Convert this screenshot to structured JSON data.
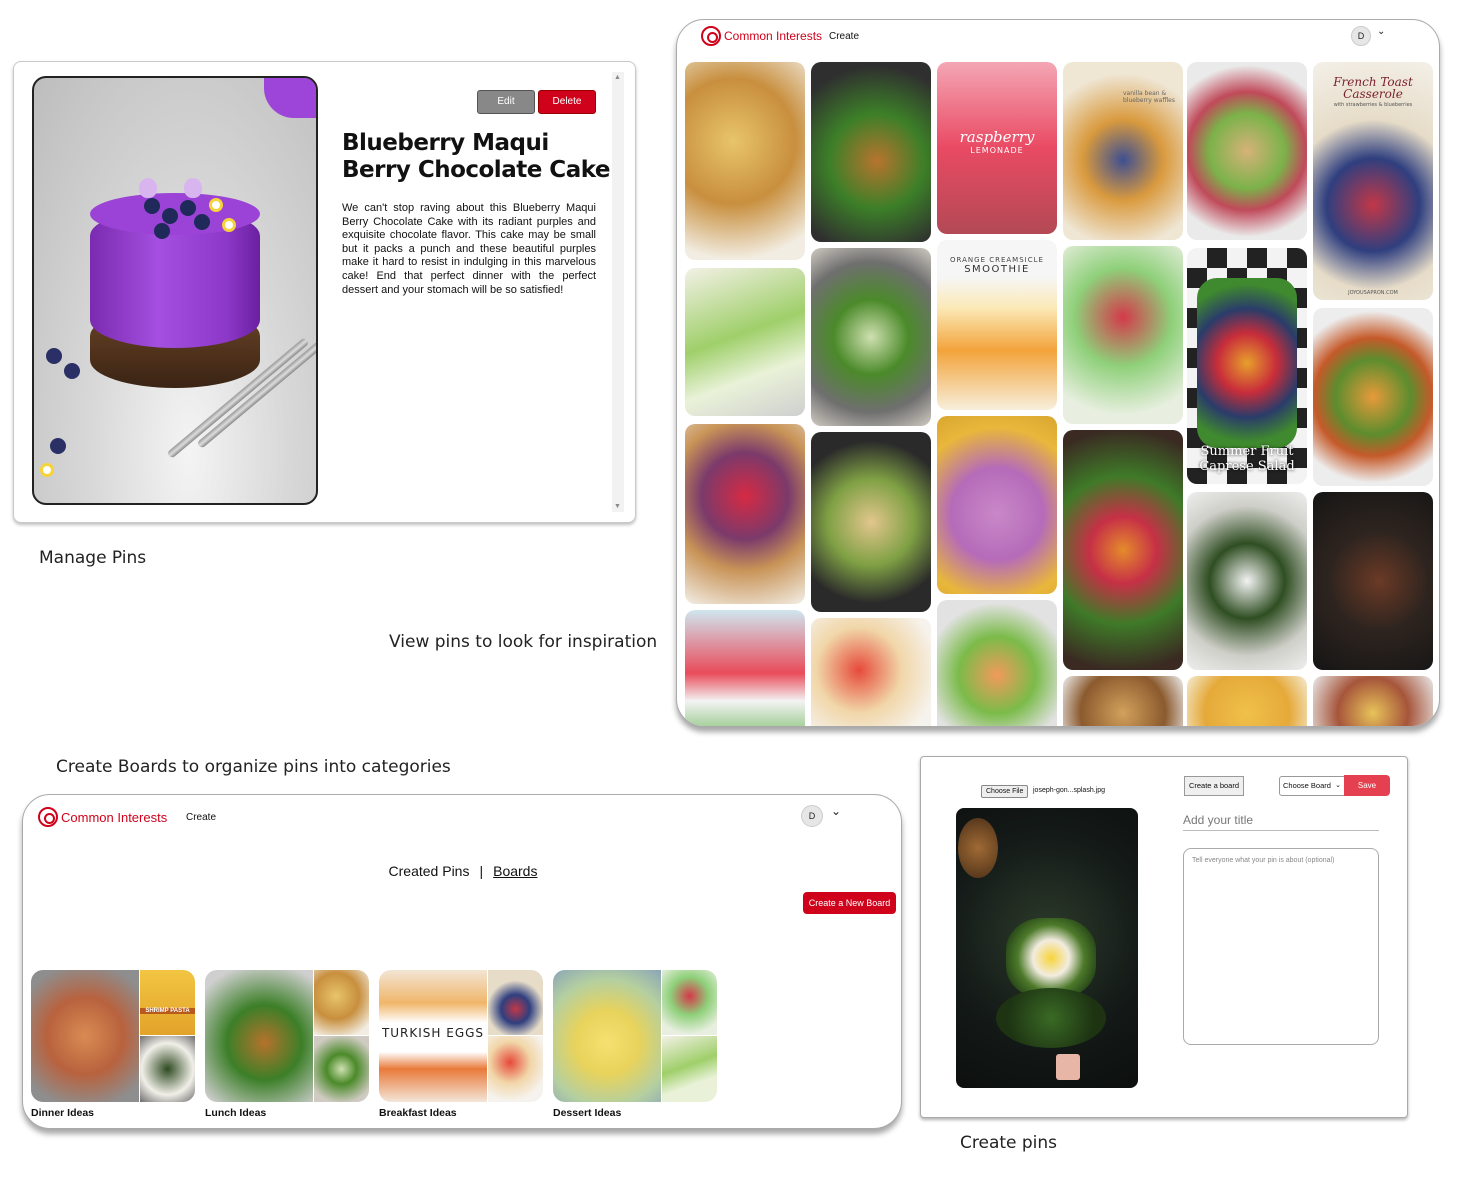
{
  "captions": {
    "manage": "Manage Pins",
    "view": "View pins to look for inspiration",
    "boards": "Create Boards to organize pins into categories",
    "create": "Create pins"
  },
  "brand": {
    "name": "Common Interests",
    "color": "#d0021b"
  },
  "nav": {
    "create": "Create",
    "avatar_letter": "D"
  },
  "manage_pin": {
    "edit_label": "Edit",
    "delete_label": "Delete",
    "title": "Blueberry Maqui Berry Chocolate Cake",
    "description": "We can't stop raving about this Blueberry Maqui Berry Chocolate Cake with its radiant purples and exquisite chocolate flavor. This cake may be small but it packs a punch and these beautiful purples make it hard to resist in indulging in this marvelous cake! End that perfect dinner with the perfect dessert and your stomach will be so satisfied!"
  },
  "feed": {
    "tile_texts": {
      "lemonade": "raspberry",
      "lemonade_sub": "LEMONADE",
      "smoothie_top": "ORANGE CREAMSICLE",
      "smoothie": "SMOOTHIE",
      "waffle": "vanilla bean & blueberry waffles",
      "casserole": "French Toast Casserole",
      "casserole_sub": "with strawberries & blueberries",
      "casserole_site": "JOYOUSAPRON.COM",
      "caprese": "Summer Fruit Caprese Salad"
    }
  },
  "boards_page": {
    "tab_created": "Created Pins",
    "tab_sep": "|",
    "tab_boards": "Boards",
    "new_board_label": "Create a New Board",
    "boards": [
      {
        "name": "Dinner Ideas",
        "tag": "SHRIMP PASTA"
      },
      {
        "name": "Lunch Ideas"
      },
      {
        "name": "Breakfast Ideas",
        "tag": "TURKISH EGGS"
      },
      {
        "name": "Dessert Ideas"
      }
    ]
  },
  "create_pin": {
    "choose_file": "Choose File",
    "file_name": "joseph-gon...splash.jpg",
    "create_board": "Create a board",
    "choose_board": "Choose Board",
    "save": "Save",
    "title_placeholder": "Add your title",
    "desc_placeholder": "Tell everyone what your pin is about (optional)"
  }
}
